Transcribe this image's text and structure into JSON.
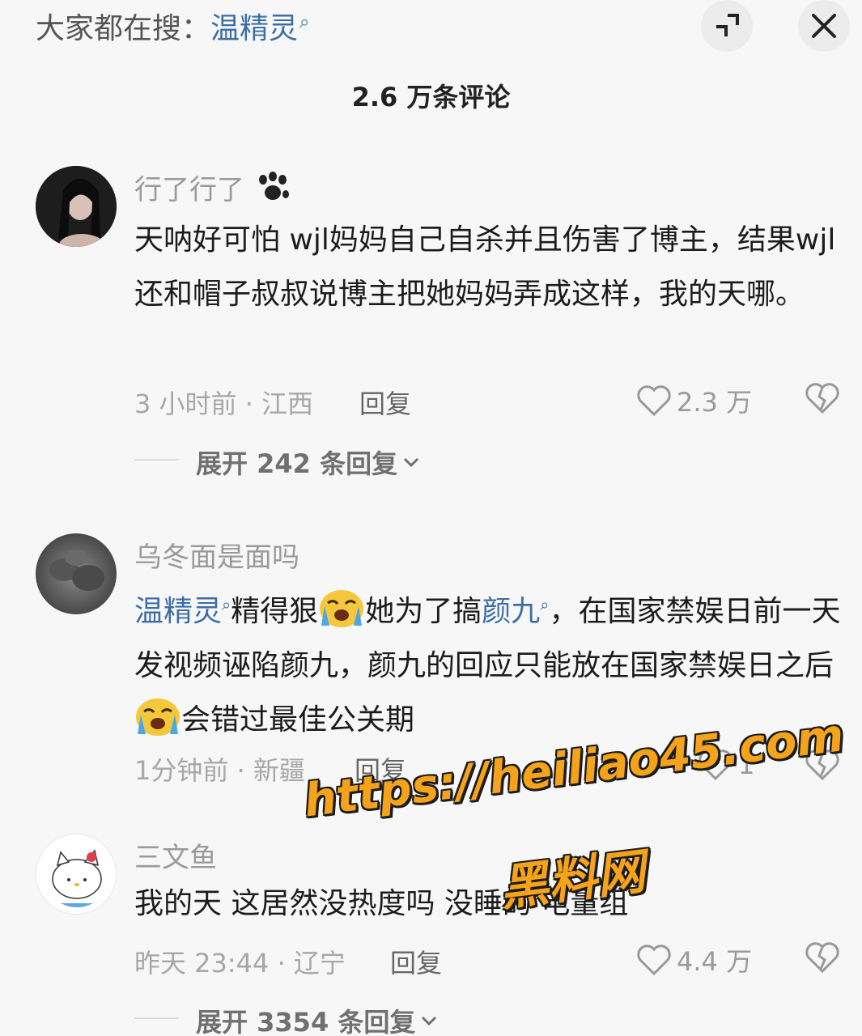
{
  "search": {
    "prefix": "大家都在搜：",
    "keyword": "温精灵"
  },
  "header": {
    "comment_count": "2.6 万条评论"
  },
  "comments": [
    {
      "username": "行了行了",
      "text": "天呐好可怕 wjl妈妈自己自杀并且伤害了博主，结果wjl还和帽子叔叔说博主把她妈妈弄成这样，我的天哪。",
      "time_location": "3 小时前 · 江西",
      "reply_label": "回复",
      "likes": "2.3 万",
      "expand_label": "展开 242 条回复"
    },
    {
      "username": "乌冬面是面吗",
      "text_parts": {
        "link1": "温精灵",
        "p1": "精得狠",
        "p2": "她为了搞",
        "link2": "颜九",
        "p3": "，在国家禁娱日前一天发视频诬陷颜九，颜九的回应只能放在国家禁娱日之后",
        "p4": "会错过最佳公关期"
      },
      "time_location": "1分钟前 · 新疆",
      "reply_label": "回复",
      "likes": "1"
    },
    {
      "username": "三文鱼",
      "text": "我的天 这居然没热度吗 没睡的 电量组",
      "time_location": "昨天 23:44 · 辽宁",
      "reply_label": "回复",
      "likes": "4.4 万",
      "expand_label": "展开 3354 条回复"
    }
  ],
  "watermark": {
    "url": "https://heiliao45.com",
    "name": "黑料网"
  },
  "icons": [
    "search-icon",
    "shrink-icon",
    "close-icon",
    "heart-icon",
    "broken-heart-icon",
    "chevron-down-icon",
    "paw-icon",
    "crying-emoji-icon"
  ],
  "colors": {
    "link": "#3c6ea5",
    "watermark": "#f5a31a",
    "background": "#f7f7f7"
  }
}
